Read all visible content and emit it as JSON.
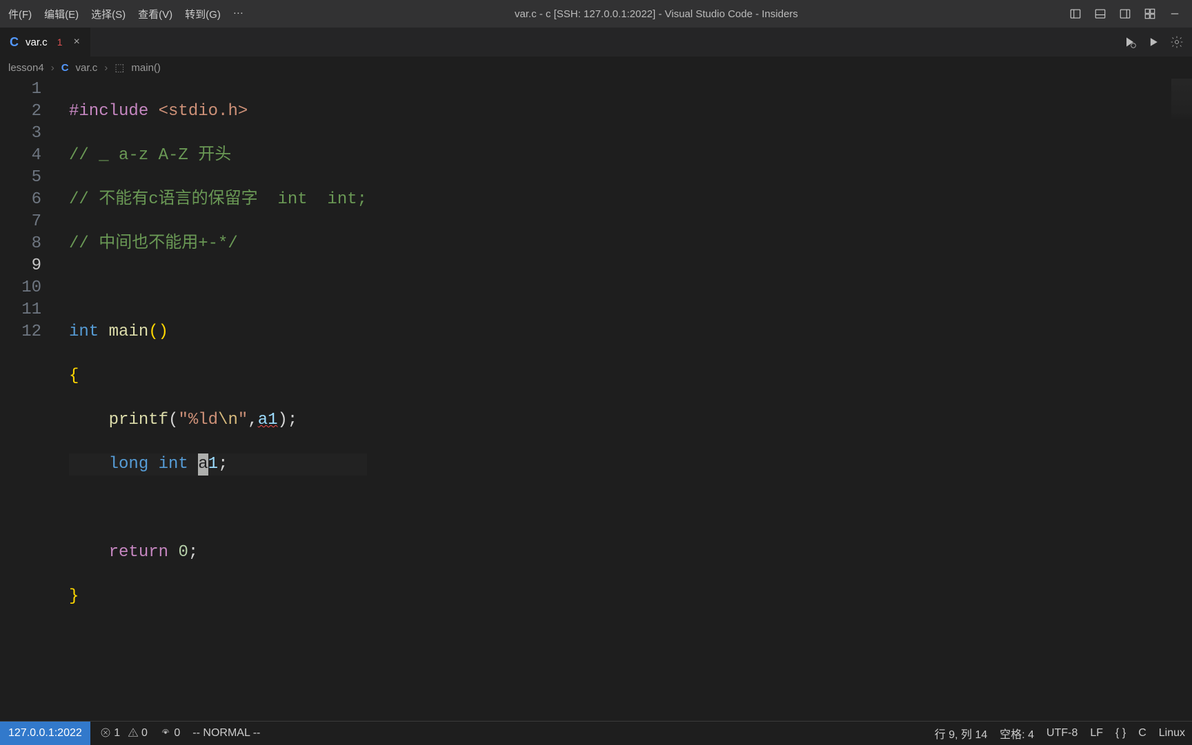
{
  "menubar": {
    "file": "件(F)",
    "edit": "编辑(E)",
    "select": "选择(S)",
    "view": "查看(V)",
    "go": "转到(G)",
    "more": "···"
  },
  "window_title": "var.c - c [SSH: 127.0.0.1:2022] - Visual Studio Code - Insiders",
  "tab": {
    "filename": "var.c",
    "error_count": "1",
    "close_glyph": "×"
  },
  "breadcrumb": {
    "folder": "lesson4",
    "file": "var.c",
    "symbol": "main()"
  },
  "code": {
    "line_numbers": [
      "1",
      "2",
      "3",
      "4",
      "5",
      "6",
      "7",
      "8",
      "9",
      "10",
      "11",
      "12"
    ],
    "active_line_index": 8,
    "l1_include": "#include",
    "l1_header": "<stdio.h>",
    "l2": "// _ a-z A-Z 开头",
    "l3": "// 不能有c语言的保留字  int  int;",
    "l4": "// 中间也不能用+-*/",
    "l6_int": "int",
    "l6_main": "main",
    "l6_parens": "()",
    "l7_brace": "{",
    "l8_printf": "printf",
    "l8_open": "(",
    "l8_q1": "\"",
    "l8_fmt": "%ld",
    "l8_esc": "\\n",
    "l8_q2": "\"",
    "l8_comma": ",",
    "l8_var": "a1",
    "l8_close": ");",
    "l9_long": "long",
    "l9_int": "int",
    "l9_sp": " ",
    "l9_cursor_a": "a",
    "l9_one": "1",
    "l9_semi": ";",
    "l11_return": "return",
    "l11_zero": "0",
    "l11_semi": ";",
    "l12_brace": "}"
  },
  "status": {
    "remote_host": "127.0.0.1:2022",
    "errors": "1",
    "warnings": "0",
    "ports": "0",
    "vim_mode": "-- NORMAL --",
    "cursor_pos": "行 9, 列 14",
    "indentation": "空格: 4",
    "encoding": "UTF-8",
    "eol": "LF",
    "lang": "C",
    "os": "Linux",
    "braces": "{ }"
  }
}
